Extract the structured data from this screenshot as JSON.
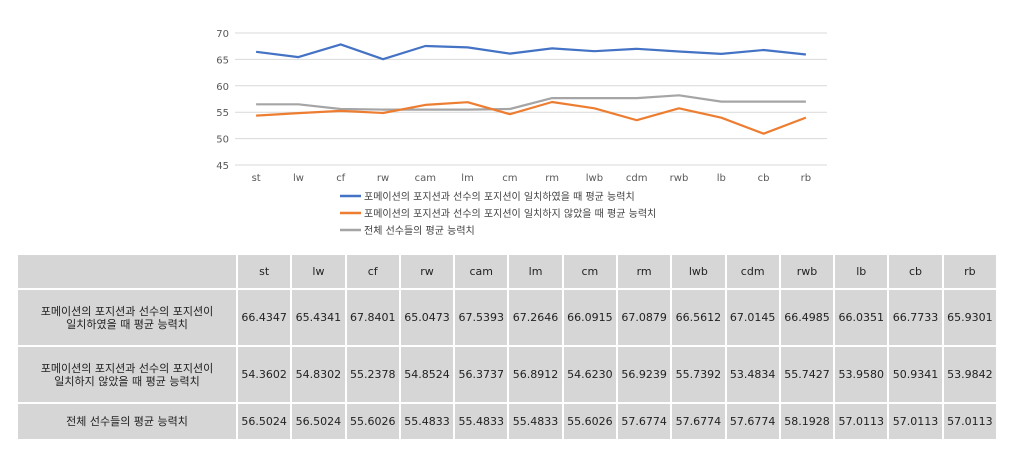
{
  "chart_data": {
    "type": "line",
    "categories": [
      "st",
      "lw",
      "cf",
      "rw",
      "cam",
      "lm",
      "cm",
      "rm",
      "lwb",
      "cdm",
      "rwb",
      "lb",
      "cb",
      "rb"
    ],
    "ylim": [
      45,
      70
    ],
    "yticks": [
      "70",
      "65",
      "60",
      "55",
      "50",
      "45"
    ],
    "grid": true,
    "legend_position": "bottom",
    "series": [
      {
        "name": "포메이션의 포지션과 선수의 포지션이 일치하였을 때 평균 능력치",
        "color": "#4472C4",
        "values": [
          66.4347,
          65.4341,
          67.8401,
          65.0473,
          67.5393,
          67.2646,
          66.0915,
          67.0879,
          66.5612,
          67.0145,
          66.4985,
          66.0351,
          66.7733,
          65.9301
        ]
      },
      {
        "name": "포메이션의 포지션과 선수의 포지션이 일치하지 않았을 때 평균 능력치",
        "color": "#ED7D31",
        "values": [
          54.3602,
          54.8302,
          55.2378,
          54.8524,
          56.3737,
          56.8912,
          54.623,
          56.9239,
          55.7392,
          53.4834,
          55.7427,
          53.958,
          50.9341,
          53.9842
        ]
      },
      {
        "name": "전체 선수들의 평균 능력치",
        "color": "#A5A5A5",
        "values": [
          56.5024,
          56.5024,
          55.6026,
          55.4833,
          55.4833,
          55.4833,
          55.6026,
          57.6774,
          57.6774,
          57.6774,
          58.1928,
          57.0113,
          57.0113,
          57.0113
        ]
      }
    ]
  },
  "table": {
    "header_corner": "",
    "columns": [
      "st",
      "lw",
      "cf",
      "rw",
      "cam",
      "lm",
      "cm",
      "rm",
      "lwb",
      "cdm",
      "rwb",
      "lb",
      "cb",
      "rb"
    ],
    "rows": [
      {
        "label_lines": [
          "포메이션의 포지션과 선수의 포지션이",
          "일치하였을 때 평균 능력치"
        ],
        "cells": [
          "66.4347",
          "65.4341",
          "67.8401",
          "65.0473",
          "67.5393",
          "67.2646",
          "66.0915",
          "67.0879",
          "66.5612",
          "67.0145",
          "66.4985",
          "66.0351",
          "66.7733",
          "65.9301"
        ]
      },
      {
        "label_lines": [
          "포메이션의 포지션과 선수의 포지션이",
          "일치하지 않았을 때 평균 능력치"
        ],
        "cells": [
          "54.3602",
          "54.8302",
          "55.2378",
          "54.8524",
          "56.3737",
          "56.8912",
          "54.6230",
          "56.9239",
          "55.7392",
          "53.4834",
          "55.7427",
          "53.9580",
          "50.9341",
          "53.9842"
        ]
      },
      {
        "label_lines": [
          "전체 선수들의 평균 능력치"
        ],
        "cells": [
          "56.5024",
          "56.5024",
          "55.6026",
          "55.4833",
          "55.4833",
          "55.4833",
          "55.6026",
          "57.6774",
          "57.6774",
          "57.6774",
          "58.1928",
          "57.0113",
          "57.0113",
          "57.0113"
        ]
      }
    ]
  }
}
